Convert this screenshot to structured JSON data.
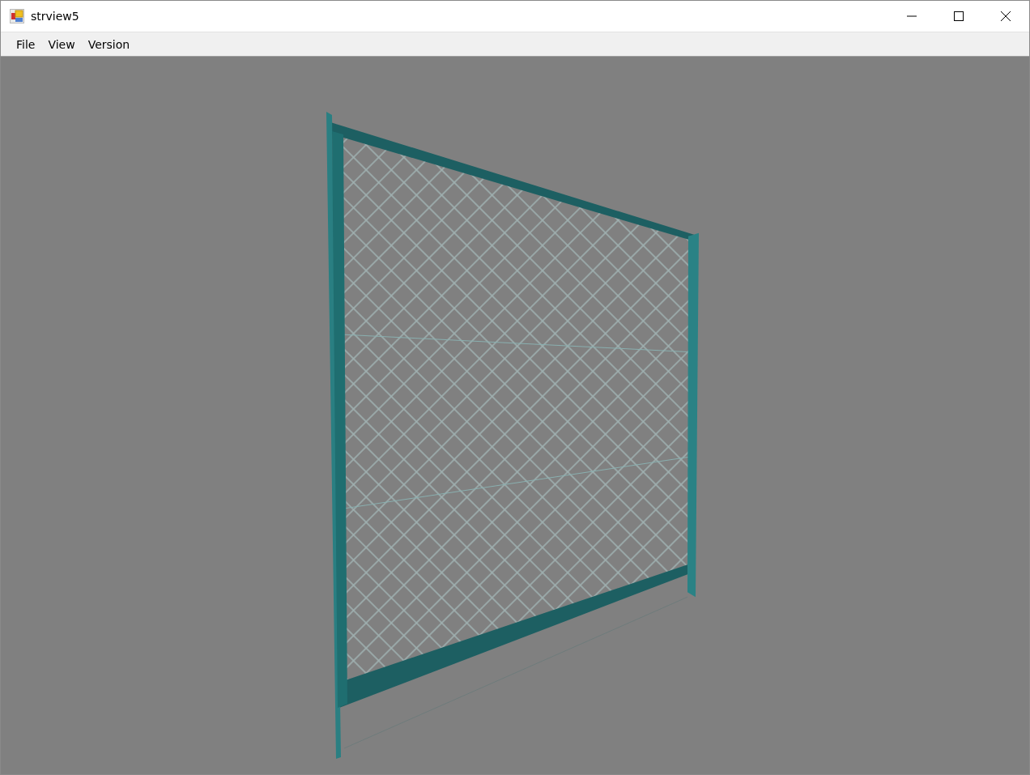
{
  "window": {
    "title": "strview5"
  },
  "menu": [
    {
      "label": "File"
    },
    {
      "label": "View"
    },
    {
      "label": "Version"
    }
  ]
}
